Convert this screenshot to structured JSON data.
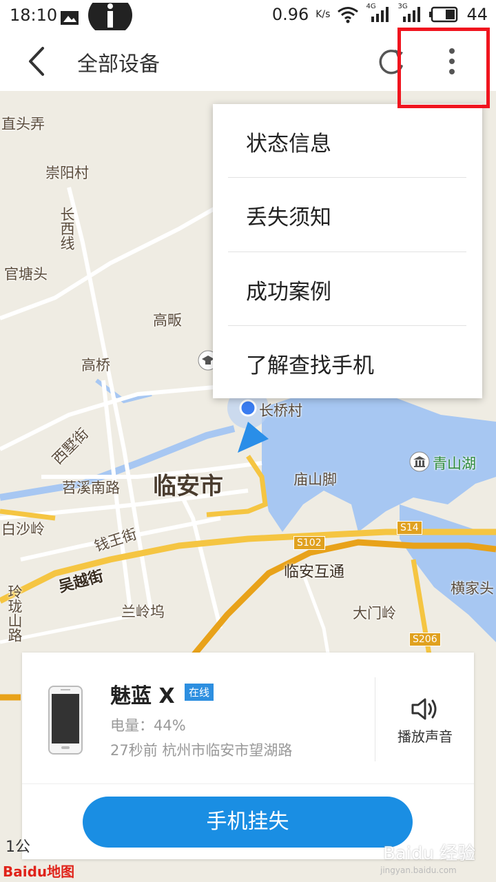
{
  "status_bar": {
    "time": "18:10",
    "net_speed": "0.96",
    "net_unit": "K/s",
    "signal1_label": "4G",
    "signal2_label": "3G",
    "battery": "44"
  },
  "header": {
    "title": "全部设备"
  },
  "menu": {
    "items": [
      {
        "label": "状态信息"
      },
      {
        "label": "丢失须知"
      },
      {
        "label": "成功案例"
      },
      {
        "label": "了解查找手机"
      }
    ]
  },
  "map": {
    "labels": {
      "zhitounong": "直头弄",
      "chongyangcun": "崇阳村",
      "changxixian": "长西线",
      "guantangtou": "官塘头",
      "gaofan": "高畈",
      "gaoqiao": "高桥",
      "changqiaocun": "长桥村",
      "qingshanhu": "青山湖",
      "xishujie": "西墅街",
      "tiaoxinanlu": "苕溪南路",
      "linanshi": "临安市",
      "miaoshanjiao": "庙山脚",
      "baishaling": "白沙岭",
      "qianwangjie": "钱王街",
      "wuyuejie": "吴越街",
      "linanhutong": "临安互通",
      "hengjiatou": "横家头",
      "linglongshanlu": "玲珑山路",
      "lanlingwu": "兰岭坞",
      "damenling": "大门岭"
    },
    "roads": {
      "s102": "S102",
      "s14": "S14",
      "s206": "S206"
    },
    "scale": "1公",
    "logo": "Baidu地图"
  },
  "device": {
    "name": "魅蓝 X",
    "status": "在线",
    "battery_text": "电量：44%",
    "location_text": "27秒前 杭州市临安市望湖路",
    "sound_label": "播放声音",
    "lost_button": "手机挂失"
  },
  "watermark": {
    "main": "Baidu 经验",
    "sub": "jingyan.baidu.com"
  },
  "colors": {
    "accent": "#1a8ee3",
    "highlight": "#f0141e",
    "water": "#a7c7f2",
    "road": "#f5c542"
  }
}
